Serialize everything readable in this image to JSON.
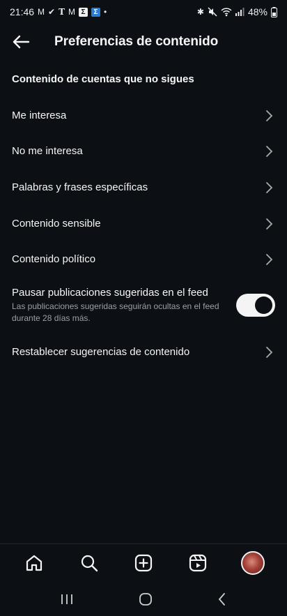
{
  "status": {
    "time": "21:46",
    "battery": "48%",
    "left_icons": [
      "mail-icon",
      "check-circle-icon",
      "nyt-icon",
      "mail-icon",
      "sigma-icon",
      "sigma-icon",
      "dot-icon"
    ],
    "right_icons": [
      "bluetooth-icon",
      "mute-icon",
      "wifi-icon",
      "signal-icon",
      "battery-icon"
    ]
  },
  "header": {
    "title": "Preferencias de contenido"
  },
  "section": {
    "title": "Contenido de cuentas que no sigues"
  },
  "items": [
    {
      "label": "Me interesa"
    },
    {
      "label": "No me interesa"
    },
    {
      "label": "Palabras y frases específicas"
    },
    {
      "label": "Contenido sensible"
    },
    {
      "label": "Contenido político"
    }
  ],
  "toggle_item": {
    "title": "Pausar publicaciones sugeridas en el feed",
    "description": "Las publicaciones sugeridas seguirán ocultas en el feed durante 28 días más.",
    "enabled": true
  },
  "reset_item": {
    "label": "Restablecer sugerencias de contenido"
  },
  "tabbar": [
    "home-icon",
    "search-icon",
    "create-icon",
    "reels-icon",
    "profile-avatar"
  ],
  "navbar": [
    "recents-icon",
    "home-circle-icon",
    "back-chevron-icon"
  ]
}
